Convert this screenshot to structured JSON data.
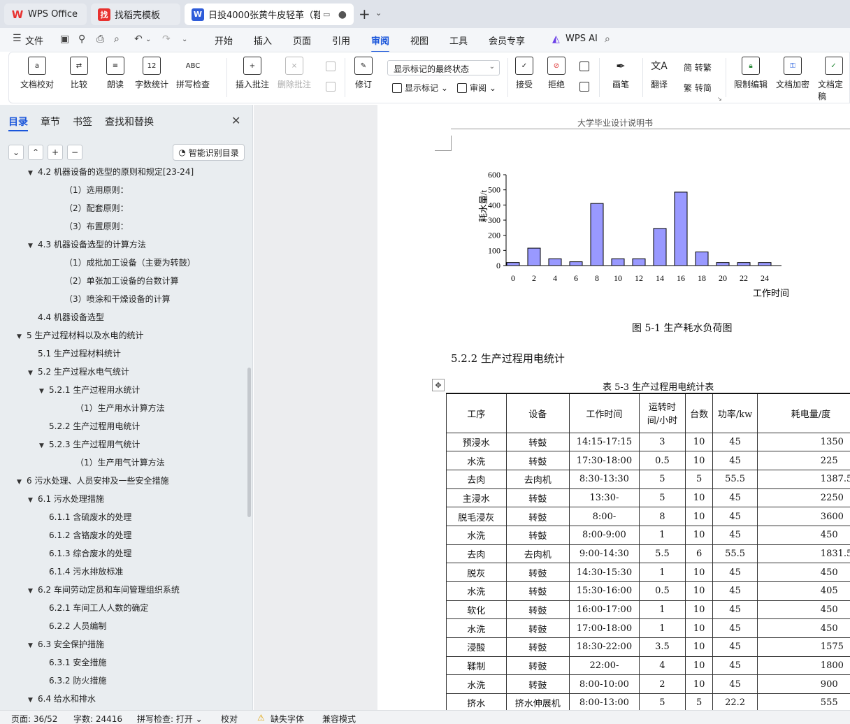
{
  "tabs": [
    {
      "label": "WPS Office",
      "logo": "W"
    },
    {
      "label": "找稻壳模板",
      "logo": "找"
    },
    {
      "label": "日投4000张黄牛皮轻革（鞋面",
      "logo": "W"
    }
  ],
  "menu": {
    "file": "文件",
    "items": [
      "开始",
      "插入",
      "页面",
      "引用",
      "审阅",
      "视图",
      "工具",
      "会员专享"
    ],
    "active": "审阅",
    "wps_ai": "WPS AI"
  },
  "ribbon": {
    "doc_check": "文档校对",
    "compare": "比较",
    "read_aloud": "朗读",
    "word_count": "字数统计",
    "spell_check": "拼写检查",
    "insert_comment": "插入批注",
    "delete_comment": "删除批注",
    "revise": "修订",
    "show_state": "显示标记的最终状态",
    "show_marks": "显示标记",
    "review": "审阅",
    "accept": "接受",
    "reject": "拒绝",
    "pen": "画笔",
    "translate": "翻译",
    "to_traditional": "简 转繁",
    "to_simplified": "繁 转简",
    "restrict_edit": "限制编辑",
    "encrypt": "文档加密",
    "finalize": "文档定稿",
    "word_count_icon_text": "12",
    "spell_icon_text": "ABC"
  },
  "nav": {
    "tabs": [
      "目录",
      "章节",
      "书签",
      "查找和替换"
    ],
    "active_tab": "目录",
    "smart_button": "智能识别目录",
    "toc": [
      {
        "text": "4.2  机器设备的选型的原则和规定[23-24]",
        "level": 2,
        "arrow": "▼"
      },
      {
        "text": "（1）选用原则：",
        "level": 4,
        "arrow": ""
      },
      {
        "text": "（2）配套原则：",
        "level": 4,
        "arrow": ""
      },
      {
        "text": "（3）布置原则：",
        "level": 4,
        "arrow": ""
      },
      {
        "text": "4.3  机器设备选型的计算方法",
        "level": 2,
        "arrow": "▼"
      },
      {
        "text": "（1）成批加工设备（主要为转鼓）",
        "level": 4,
        "arrow": ""
      },
      {
        "text": "（2）单张加工设备的台数计算",
        "level": 4,
        "arrow": ""
      },
      {
        "text": "（3）喷涂和干燥设备的计算",
        "level": 4,
        "arrow": ""
      },
      {
        "text": "4.4  机器设备选型",
        "level": 2,
        "arrow": ""
      },
      {
        "text": "5  生产过程材料以及水电的统计",
        "level": 1,
        "arrow": "▼"
      },
      {
        "text": "5.1  生产过程材料统计",
        "level": 2,
        "arrow": ""
      },
      {
        "text": "5.2  生产过程水电气统计",
        "level": 2,
        "arrow": "▼"
      },
      {
        "text": "5.2.1 生产过程用水统计",
        "level": 3,
        "arrow": "▼"
      },
      {
        "text": "（1）生产用水计算方法",
        "level": 5,
        "arrow": ""
      },
      {
        "text": "5.2.2  生产过程用电统计",
        "level": 3,
        "arrow": ""
      },
      {
        "text": "5.2.3  生产过程用气统计",
        "level": 3,
        "arrow": "▼"
      },
      {
        "text": "（1）生产用气计算方法",
        "level": 5,
        "arrow": ""
      },
      {
        "text": "6  污水处理、人员安排及一些安全措施",
        "level": 1,
        "arrow": "▼"
      },
      {
        "text": "6.1  污水处理措施",
        "level": 2,
        "arrow": "▼"
      },
      {
        "text": "6.1.1  含硫废水的处理",
        "level": 3,
        "arrow": ""
      },
      {
        "text": "6.1.2  含铬废水的处理",
        "level": 3,
        "arrow": ""
      },
      {
        "text": "6.1.3  综合废水的处理",
        "level": 3,
        "arrow": ""
      },
      {
        "text": "6.1.4  污水排放标准",
        "level": 3,
        "arrow": ""
      },
      {
        "text": "6.2  车间劳动定员和车间管理组织系统",
        "level": 2,
        "arrow": "▼"
      },
      {
        "text": "6.2.1  车间工人人数的确定",
        "level": 3,
        "arrow": ""
      },
      {
        "text": "6.2.2  人员编制",
        "level": 3,
        "arrow": ""
      },
      {
        "text": "6.3  安全保护措施",
        "level": 2,
        "arrow": "▼"
      },
      {
        "text": "6.3.1  安全措施",
        "level": 3,
        "arrow": ""
      },
      {
        "text": "6.3.2  防火措施",
        "level": 3,
        "arrow": ""
      },
      {
        "text": "6.4  给水和排水",
        "level": 2,
        "arrow": "▼"
      }
    ]
  },
  "document": {
    "header": "大学毕业设计说明书",
    "figure_caption": "图 5-1  生产耗水负荷图",
    "section_heading": "5.2.2  生产过程用电统计",
    "table_caption": "表 5-3  生产过程用电统计表",
    "table_headers": [
      "工序",
      "设备",
      "工作时间",
      "运转时间/小时",
      "台数",
      "功率/kw",
      "耗电量/度"
    ],
    "table_header_runtime_l1": "运转时",
    "table_header_runtime_l2": "间/小时",
    "table_rows": [
      [
        "预浸水",
        "转鼓",
        "14:15-17:15",
        "3",
        "10",
        "45",
        "1350"
      ],
      [
        "水洗",
        "转鼓",
        "17:30-18:00",
        "0.5",
        "10",
        "45",
        "225"
      ],
      [
        "去肉",
        "去肉机",
        "8:30-13:30",
        "5",
        "5",
        "55.5",
        "1387.5"
      ],
      [
        "主浸水",
        "转鼓",
        "13:30-",
        "5",
        "10",
        "45",
        "2250"
      ],
      [
        "脱毛浸灰",
        "转鼓",
        "8:00-",
        "8",
        "10",
        "45",
        "3600"
      ],
      [
        "水洗",
        "转鼓",
        "8:00-9:00",
        "1",
        "10",
        "45",
        "450"
      ],
      [
        "去肉",
        "去肉机",
        "9:00-14:30",
        "5.5",
        "6",
        "55.5",
        "1831.5"
      ],
      [
        "脱灰",
        "转鼓",
        "14:30-15:30",
        "1",
        "10",
        "45",
        "450"
      ],
      [
        "水洗",
        "转鼓",
        "15:30-16:00",
        "0.5",
        "10",
        "45",
        "405"
      ],
      [
        "软化",
        "转鼓",
        "16:00-17:00",
        "1",
        "10",
        "45",
        "450"
      ],
      [
        "水洗",
        "转鼓",
        "17:00-18:00",
        "1",
        "10",
        "45",
        "450"
      ],
      [
        "浸酸",
        "转鼓",
        "18:30-22:00",
        "3.5",
        "10",
        "45",
        "1575"
      ],
      [
        "鞣制",
        "转鼓",
        "22:00-",
        "4",
        "10",
        "45",
        "1800"
      ],
      [
        "水洗",
        "转鼓",
        "8:00-10:00",
        "2",
        "10",
        "45",
        "900"
      ],
      [
        "挤水",
        "挤水伸展机",
        "8:00-13:00",
        "5",
        "5",
        "22.2",
        "555"
      ]
    ]
  },
  "chart_data": {
    "type": "bar",
    "x": [
      0,
      2,
      4,
      6,
      8,
      10,
      12,
      14,
      16,
      18,
      20,
      22,
      24
    ],
    "categories": [
      "0",
      "2",
      "4",
      "6",
      "8",
      "10",
      "12",
      "14",
      "16",
      "18",
      "20",
      "22",
      "24"
    ],
    "values": [
      20,
      115,
      45,
      25,
      410,
      45,
      45,
      245,
      485,
      90,
      20,
      20,
      20
    ],
    "xlabel": "工作时间",
    "ylabel": "耗水量/t",
    "ylim": [
      0,
      600
    ],
    "yticks": [
      0,
      100,
      200,
      300,
      400,
      500,
      600
    ],
    "bar_color": "#9999ff",
    "grid": false
  },
  "status": {
    "page": "页面: 36/52",
    "words": "字数: 24416",
    "spell": "拼写检查: 打开",
    "proof": "校对",
    "missing_font": "缺失字体",
    "compat": "兼容模式"
  },
  "colors": {
    "accent": "#1a56db",
    "wps_red": "#e8312f"
  }
}
